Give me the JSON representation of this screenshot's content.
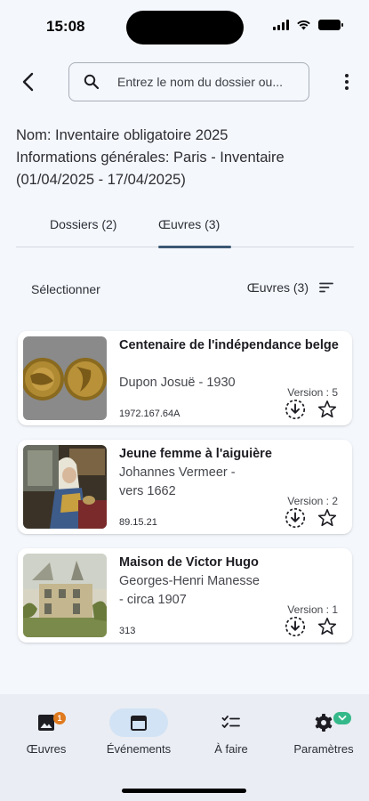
{
  "status_bar": {
    "time": "15:08"
  },
  "search": {
    "placeholder": "Entrez le nom du dossier ou..."
  },
  "info": {
    "name_line": "Nom: Inventaire obligatoire 2025",
    "general_line": "Informations générales: Paris - Inventaire",
    "dates_line": "(01/04/2025 - 17/04/2025)"
  },
  "tabs": [
    {
      "label": "Dossiers (2)",
      "active": false
    },
    {
      "label": "Œuvres (3)",
      "active": true
    }
  ],
  "toolbar": {
    "select_label": "Sélectionner",
    "sort_label": "Œuvres (3)"
  },
  "artworks": [
    {
      "title": "Centenaire de l'indépendance belge",
      "author": "Dupon Josuë - 1930",
      "inventory": "1972.167.64A",
      "version": "Version : 5"
    },
    {
      "title": "Jeune femme à l'aiguière",
      "author": "Johannes Vermeer - vers 1662",
      "inventory": "89.15.21",
      "version": "Version : 2"
    },
    {
      "title": "Maison de Victor Hugo",
      "author": "Georges-Henri Manesse - circa 1907",
      "inventory": "313",
      "version": "Version : 1"
    }
  ],
  "bottom_nav": {
    "items": [
      {
        "label": "Œuvres",
        "icon": "image-icon",
        "badge": "1"
      },
      {
        "label": "Événements",
        "icon": "calendar-icon",
        "active": true
      },
      {
        "label": "À faire",
        "icon": "checklist-icon"
      },
      {
        "label": "Paramètres",
        "icon": "gear-icon",
        "badge_icon": "chevron-down-icon"
      }
    ]
  },
  "colors": {
    "accent": "#3a5874",
    "nav_active": "#d2e3f5",
    "badge_orange": "#e07a1f",
    "badge_green": "#35b98a",
    "background": "#f4f7fc"
  }
}
